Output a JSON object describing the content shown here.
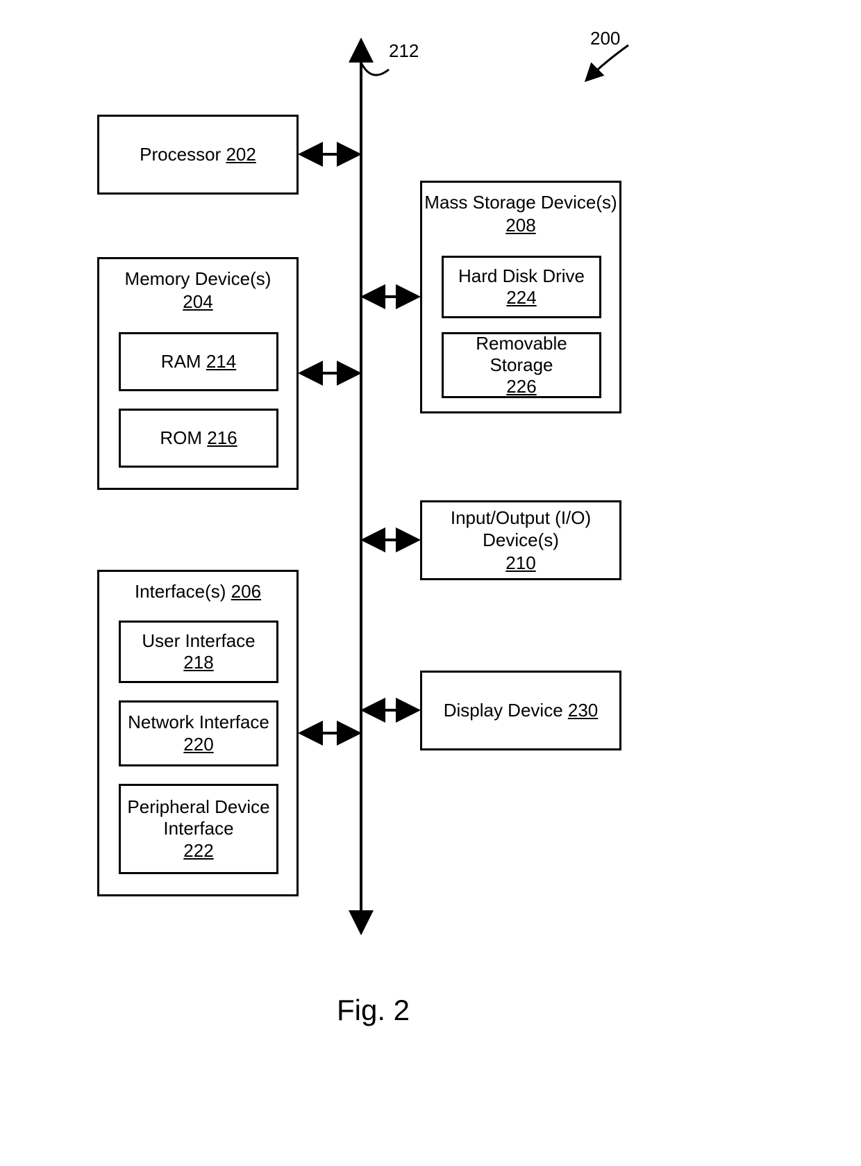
{
  "figure": {
    "caption": "Fig. 2",
    "system_ref": "200",
    "bus_ref": "212"
  },
  "blocks": {
    "processor": {
      "label": "Processor",
      "ref": "202"
    },
    "memory": {
      "label": "Memory Device(s)",
      "ref": "204",
      "ram": {
        "label": "RAM",
        "ref": "214"
      },
      "rom": {
        "label": "ROM",
        "ref": "216"
      }
    },
    "interfaces": {
      "label": "Interface(s)",
      "ref": "206",
      "user": {
        "label": "User Interface",
        "ref": "218"
      },
      "net": {
        "label": "Network Interface",
        "ref": "220"
      },
      "periph": {
        "label": "Peripheral Device Interface",
        "ref": "222"
      }
    },
    "mass_storage": {
      "label": "Mass Storage Device(s)",
      "ref": "208",
      "hdd": {
        "label": "Hard Disk Drive",
        "ref": "224"
      },
      "rem": {
        "label": "Removable Storage",
        "ref": "226"
      }
    },
    "io": {
      "label": "Input/Output (I/O) Device(s)",
      "ref": "210"
    },
    "display": {
      "label": "Display Device",
      "ref": "230"
    }
  }
}
